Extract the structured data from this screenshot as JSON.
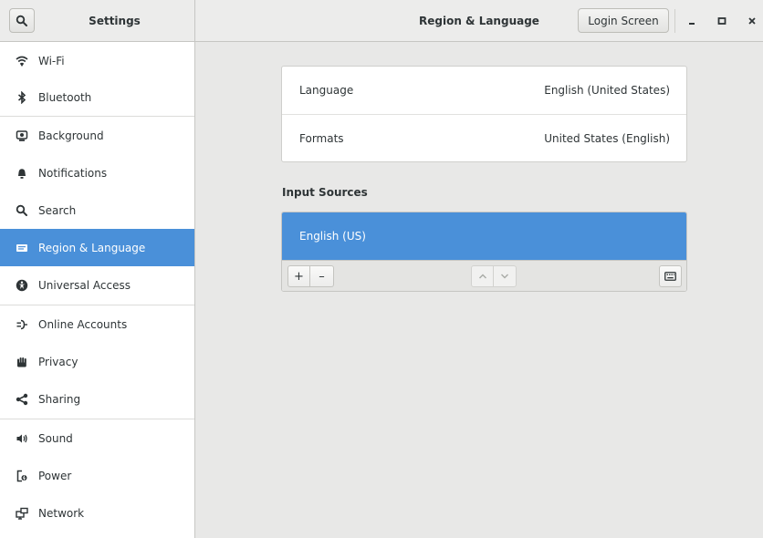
{
  "header": {
    "sidebar_title": "Settings",
    "page_title": "Region & Language",
    "login_screen_label": "Login Screen"
  },
  "icons": {
    "search": "search-icon",
    "minimize": "minimize-icon",
    "maximize": "maximize-icon",
    "close": "close-icon"
  },
  "sidebar": {
    "items": [
      {
        "label": "Wi-Fi",
        "icon": "wifi-icon"
      },
      {
        "label": "Bluetooth",
        "icon": "bluetooth-icon"
      },
      {
        "label": "Background",
        "icon": "background-icon"
      },
      {
        "label": "Notifications",
        "icon": "bell-icon"
      },
      {
        "label": "Search",
        "icon": "search-icon"
      },
      {
        "label": "Region & Language",
        "icon": "flag-icon",
        "active": true
      },
      {
        "label": "Universal Access",
        "icon": "accessibility-icon"
      },
      {
        "label": "Online Accounts",
        "icon": "online-accounts-icon"
      },
      {
        "label": "Privacy",
        "icon": "hand-icon"
      },
      {
        "label": "Sharing",
        "icon": "share-icon"
      },
      {
        "label": "Sound",
        "icon": "speaker-icon"
      },
      {
        "label": "Power",
        "icon": "power-icon"
      },
      {
        "label": "Network",
        "icon": "network-icon"
      }
    ]
  },
  "main": {
    "language": {
      "label": "Language",
      "value": "English (United States)"
    },
    "formats": {
      "label": "Formats",
      "value": "United States (English)"
    },
    "input_sources_label": "Input Sources",
    "input_sources": [
      {
        "label": "English (US)",
        "selected": true
      }
    ],
    "toolbar": {
      "add": "+",
      "remove": "–"
    }
  },
  "colors": {
    "accent": "#4a90d9",
    "sidebar_bg": "#ffffff",
    "content_bg": "#e8e8e7",
    "header_bg": "#ececeb",
    "text": "#2e3436"
  }
}
